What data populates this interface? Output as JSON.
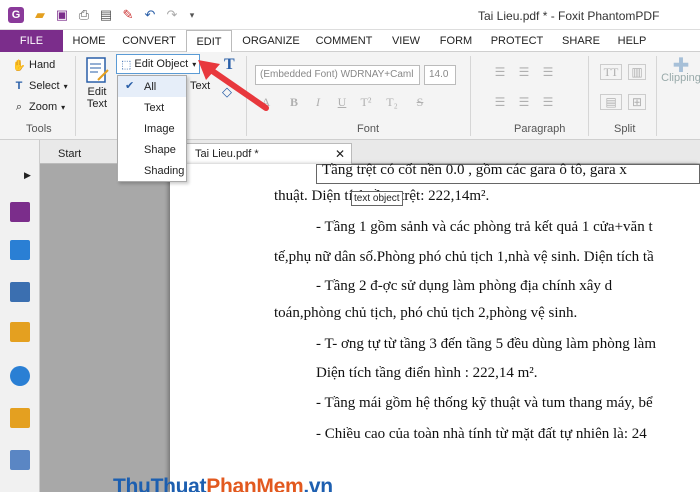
{
  "window": {
    "title": "Tai Lieu.pdf * - Foxit PhantomPDF"
  },
  "ribbon_tabs": [
    "FILE",
    "HOME",
    "CONVERT",
    "EDIT",
    "ORGANIZE",
    "COMMENT",
    "VIEW",
    "FORM",
    "PROTECT",
    "SHARE",
    "HELP"
  ],
  "active_tab": "EDIT",
  "tools": {
    "hand": "Hand",
    "select": "Select",
    "zoom": "Zoom",
    "group_label": "Tools"
  },
  "edit_text": {
    "line1": "Edit",
    "line2": "Text"
  },
  "edit_object": {
    "label": "Edit Object"
  },
  "edit_object_menu": {
    "items": [
      "All",
      "Text",
      "Image",
      "Shape",
      "Shading"
    ],
    "checked": "All"
  },
  "partial_label": "Text",
  "font": {
    "family": "(Embedded Font) WDRNAY+Caml",
    "size": "14.0",
    "group_label": "Font"
  },
  "paragraph": {
    "group_label": "Paragraph"
  },
  "split": {
    "group_label": "Split"
  },
  "clipping": {
    "label": "Clipping"
  },
  "doc_tabs": {
    "start": "Start",
    "current": "Tai Lieu.pdf *"
  },
  "tooltip": "text object",
  "document_lines": [
    "Tầng trệt có cốt nền 0.0 , gồm các gara ô tô, gara x",
    "thuật. Diện tích tầng trệt: 222,14m².",
    "- Tầng 1 gồm sảnh và các phòng trả kết quả 1 cửa+văn t",
    "tế,phụ nữ dân số.Phòng phó chủ tịch 1,nhà vệ sinh. Diện tích tầ",
    "- Tầng 2 đ-ợc sử dụng làm phòng địa chính xây d",
    "toán,phòng chủ tịch, phó chủ tịch 2,phòng vệ sinh.",
    "- T- ơng tự từ tầng 3 đến tầng 5 đều dùng làm phòng làm",
    "Diện tích tầng điển hình  : 222,14 m².",
    "- Tầng mái gồm hệ thống kỹ thuật và tum thang máy, bể",
    "-  Chiều cao của toàn nhà tính từ mặt đất tự nhiên là:  24"
  ],
  "watermark": {
    "part1": "ThuThuat",
    "part2": "PhanMem",
    "part3": ".vn"
  },
  "colors": {
    "file_tab": "#7b2d8b",
    "accent": "#5b9bd5",
    "arrow": "#e8383d"
  }
}
